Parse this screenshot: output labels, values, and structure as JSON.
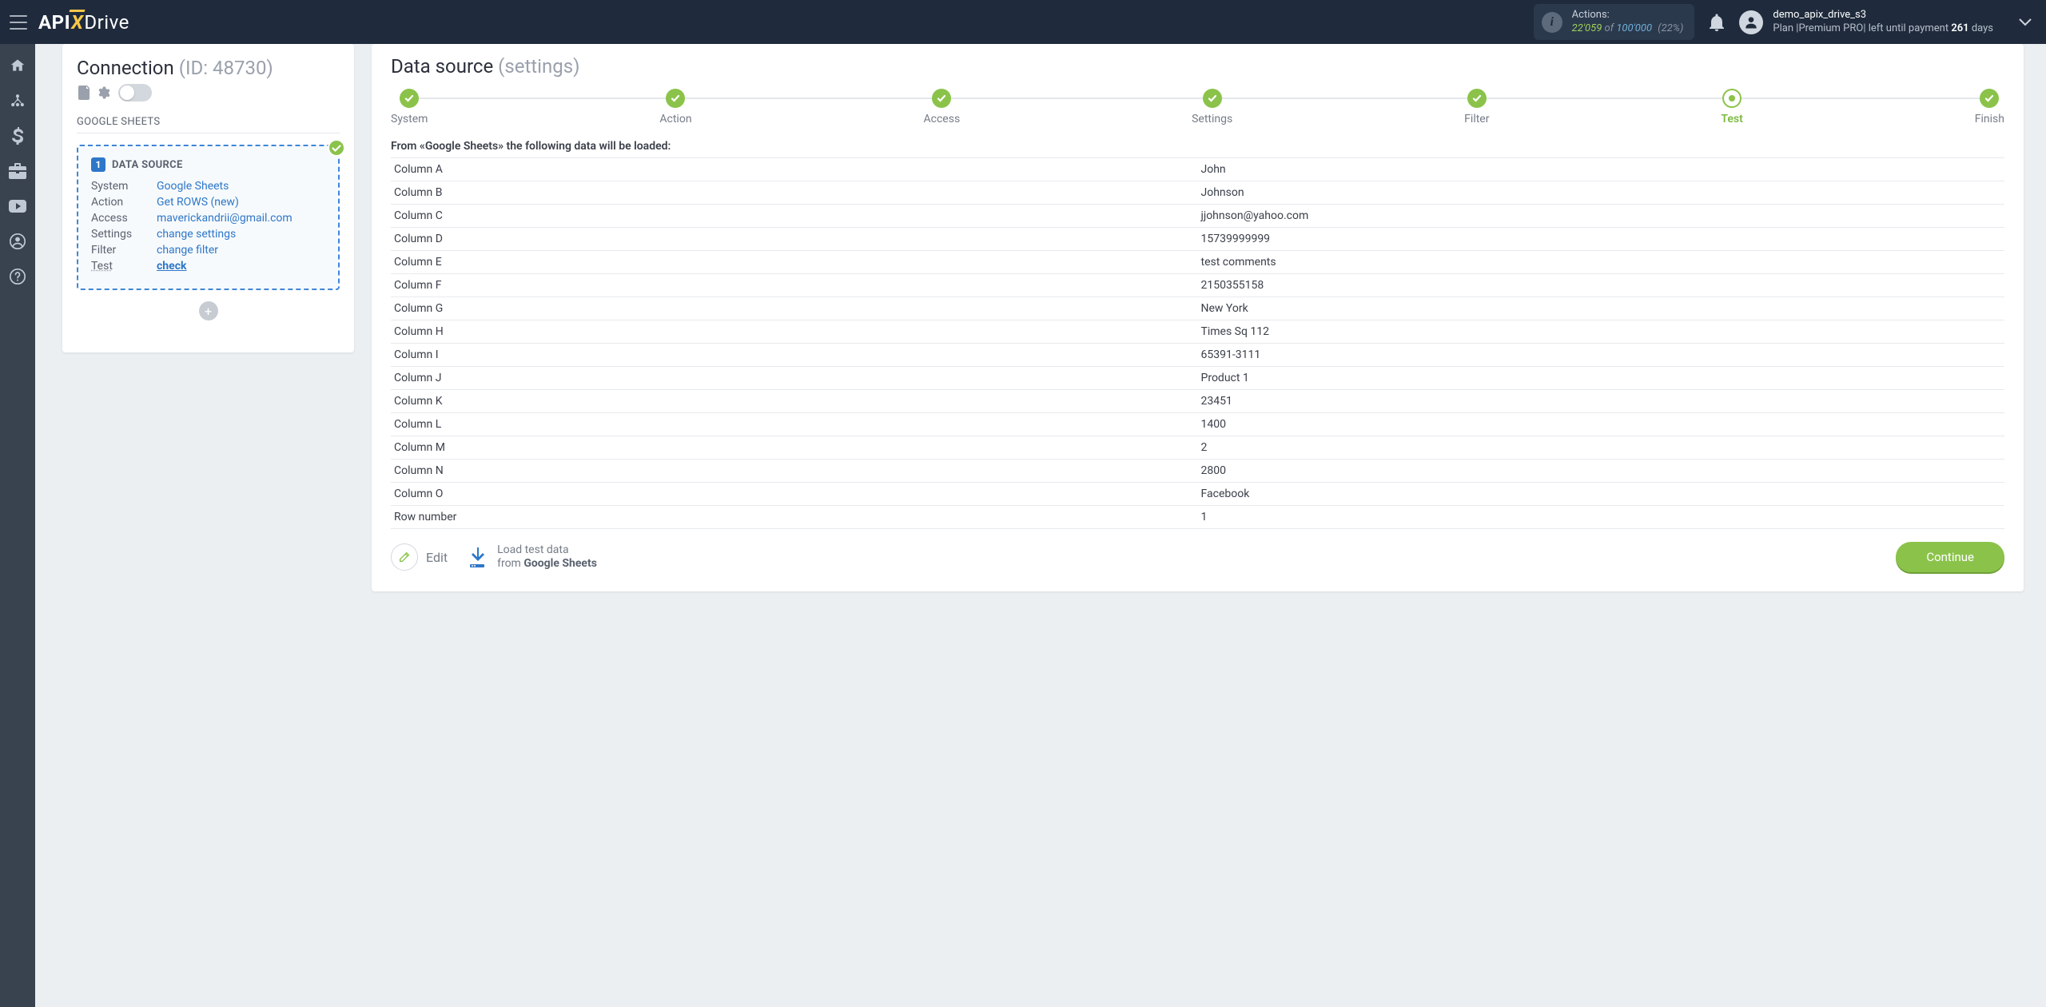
{
  "header": {
    "logo": {
      "part1": "API",
      "accent": "X",
      "part2": "Drive"
    },
    "actions": {
      "label": "Actions:",
      "current": "22'059",
      "of": "of",
      "max": "100'000",
      "percent": "(22%)"
    },
    "user": {
      "name": "demo_apix_drive_s3",
      "plan_prefix": "Plan |",
      "plan_name": "Premium PRO",
      "plan_mid": "| left until payment ",
      "days": "261",
      "plan_suffix": " days"
    }
  },
  "left": {
    "title": "Connection",
    "id_label": "(ID: 48730)",
    "source": "GOOGLE SHEETS",
    "data_source_title": "DATA SOURCE",
    "rows": [
      {
        "k": "System",
        "v": "Google Sheets",
        "link": true
      },
      {
        "k": "Action",
        "v": "Get ROWS (new)",
        "link": true
      },
      {
        "k": "Access",
        "v": "maverickandrii@gmail.com",
        "link": true
      },
      {
        "k": "Settings",
        "v": "change settings",
        "link": true
      },
      {
        "k": "Filter",
        "v": "change filter",
        "link": true
      },
      {
        "k": "Test",
        "v": "check",
        "link": true,
        "test": true
      }
    ]
  },
  "right": {
    "title": "Data source",
    "subtitle": "(settings)",
    "steps": [
      {
        "label": "System",
        "state": "done"
      },
      {
        "label": "Action",
        "state": "done"
      },
      {
        "label": "Access",
        "state": "done"
      },
      {
        "label": "Settings",
        "state": "done"
      },
      {
        "label": "Filter",
        "state": "done"
      },
      {
        "label": "Test",
        "state": "current"
      },
      {
        "label": "Finish",
        "state": "done"
      }
    ],
    "note": "From «Google Sheets» the following data will be loaded:",
    "table": [
      {
        "k": "Column A",
        "v": "John"
      },
      {
        "k": "Column B",
        "v": "Johnson"
      },
      {
        "k": "Column C",
        "v": "jjohnson@yahoo.com"
      },
      {
        "k": "Column D",
        "v": "15739999999"
      },
      {
        "k": "Column E",
        "v": "test comments"
      },
      {
        "k": "Column F",
        "v": "2150355158"
      },
      {
        "k": "Column G",
        "v": "New York"
      },
      {
        "k": "Column H",
        "v": "Times Sq 112"
      },
      {
        "k": "Column I",
        "v": "65391-3111"
      },
      {
        "k": "Column J",
        "v": "Product 1"
      },
      {
        "k": "Column K",
        "v": "23451"
      },
      {
        "k": "Column L",
        "v": "1400"
      },
      {
        "k": "Column M",
        "v": "2"
      },
      {
        "k": "Column N",
        "v": "2800"
      },
      {
        "k": "Column O",
        "v": "Facebook"
      },
      {
        "k": "Row number",
        "v": "1"
      }
    ],
    "edit_label": "Edit",
    "load_line1": "Load test data",
    "load_line2_prefix": "from ",
    "load_line2_bold": "Google Sheets",
    "continue": "Continue"
  }
}
